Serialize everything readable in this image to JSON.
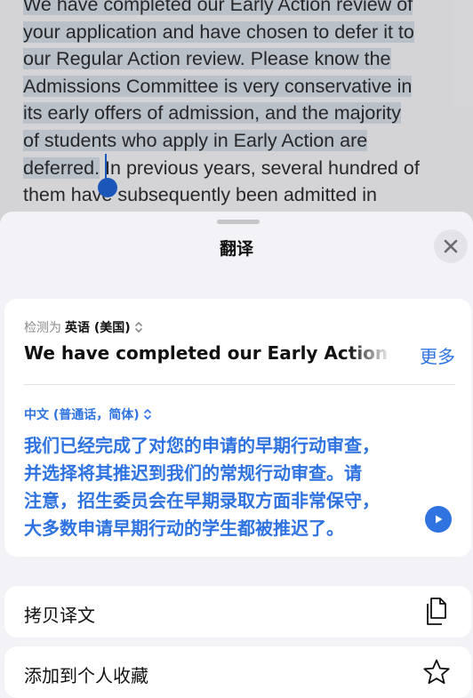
{
  "document": {
    "lines": [
      {
        "before": "",
        "highlight": "We have completed our Early Action review of",
        "after": ""
      },
      {
        "before": "",
        "highlight": "your application and have chosen to defer it to",
        "after": ""
      },
      {
        "before": "",
        "highlight": "our Regular Action review. Please know the",
        "after": ""
      },
      {
        "before": "",
        "highlight": "Admissions Committee is very conservative in",
        "after": ""
      },
      {
        "before": "",
        "highlight": "its early offers of admission, and the majority",
        "after": ""
      },
      {
        "before": "",
        "highlight": "of students who apply in Early Action are",
        "after": ""
      },
      {
        "before": "",
        "highlight": "deferred.",
        "after": " In previous years, several hundred of"
      },
      {
        "before": "them have subsequently been admitted in",
        "highlight": "",
        "after": ""
      }
    ]
  },
  "sheet": {
    "title": "翻译",
    "close_icon": "close-icon"
  },
  "source": {
    "detected_prefix": "检测为",
    "language": "英语 (美国)",
    "text": "We have completed our Early Action review",
    "more_label": "更多"
  },
  "target": {
    "language": "中文 (普通话，简体)",
    "text_lines": [
      "我们已经完成了对您的申请的早期行动审查，",
      "并选择将其推迟到我们的常规行动审查。请",
      "注意，招生委员会在早期录取方面非常保守，",
      "大多数申请早期行动的学生都被推迟了。"
    ]
  },
  "actions": [
    {
      "label": "拷贝译文",
      "icon": "copy-icon"
    },
    {
      "label": "添加到个人收藏",
      "icon": "star-icon"
    }
  ],
  "colors": {
    "accent": "#2f73e0",
    "highlight": "#c9d1da"
  }
}
